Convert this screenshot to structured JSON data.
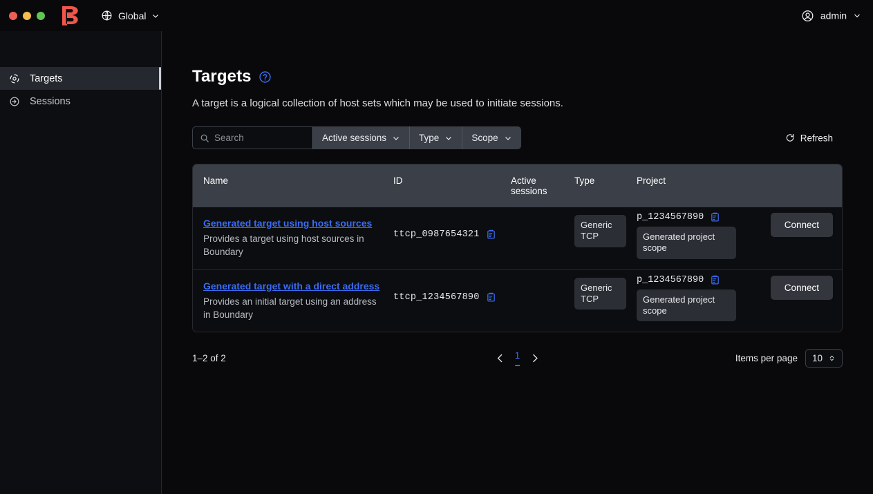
{
  "window": {
    "traffic_lights": [
      "close",
      "minimize",
      "maximize"
    ],
    "brand": "boundary-logo",
    "brand_color": "#f0564a"
  },
  "topbar": {
    "scope_label": "Global",
    "scope_icon": "globe-icon",
    "scope_chevron": "chevron-down-icon",
    "user_label": "admin",
    "user_icon": "user-circle-icon",
    "user_chevron": "chevron-down-icon"
  },
  "sidebar": {
    "items": [
      {
        "label": "Targets",
        "icon": "target-icon",
        "active": true
      },
      {
        "label": "Sessions",
        "icon": "session-arrow-icon",
        "active": false
      }
    ]
  },
  "main": {
    "title": "Targets",
    "help_icon": "help-circle-icon",
    "description": "A target is a logical collection of host sets which may be used to initiate sessions."
  },
  "toolbar": {
    "search_placeholder": "Search",
    "search_value": "",
    "search_icon": "search-icon",
    "filters": [
      {
        "label": "Active sessions",
        "icon": "chevron-down-icon"
      },
      {
        "label": "Type",
        "icon": "chevron-down-icon"
      },
      {
        "label": "Scope",
        "icon": "chevron-down-icon"
      }
    ],
    "refresh_label": "Refresh",
    "refresh_icon": "refresh-icon"
  },
  "table": {
    "columns": [
      "Name",
      "ID",
      "Active sessions",
      "Type",
      "Project"
    ],
    "rows": [
      {
        "name": "Generated target using host sources",
        "description": "Provides a target using host sources in Boundary",
        "id": "ttcp_0987654321",
        "copy_icon": "copy-clipboard-icon",
        "active_sessions": "",
        "type": "Generic TCP",
        "project_id": "p_1234567890",
        "project_copy_icon": "copy-clipboard-icon",
        "project_scope": "Generated project scope",
        "connect_label": "Connect"
      },
      {
        "name": "Generated target with a direct address",
        "description": "Provides an initial target using an address in Boundary",
        "id": "ttcp_1234567890",
        "copy_icon": "copy-clipboard-icon",
        "active_sessions": "",
        "type": "Generic TCP",
        "project_id": "p_1234567890",
        "project_copy_icon": "copy-clipboard-icon",
        "project_scope": "Generated project scope",
        "connect_label": "Connect"
      }
    ]
  },
  "pagination": {
    "range_text": "1–2 of 2",
    "prev_icon": "chevron-left-icon",
    "next_icon": "chevron-right-icon",
    "current_page": "1",
    "items_per_page_label": "Items per page",
    "items_per_page_value": "10",
    "items_per_page_icon": "chevron-updown-icon"
  },
  "colors": {
    "accent_link": "#3a6cf0",
    "brand_red": "#f0564a",
    "page_bg": "#09090b",
    "header_row_bg": "#3b3f47"
  }
}
